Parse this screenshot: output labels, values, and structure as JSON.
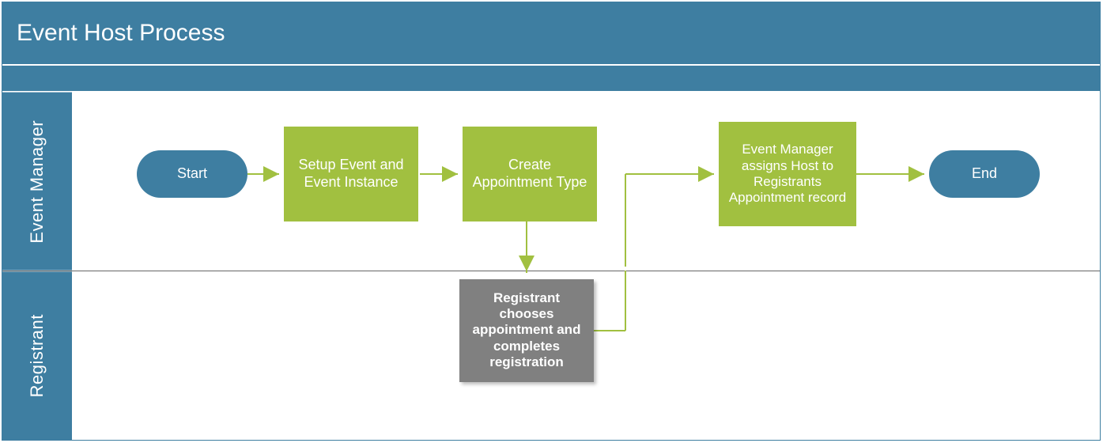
{
  "diagram": {
    "title": "Event Host Process",
    "lanes": {
      "em": {
        "label": "Event Manager"
      },
      "reg": {
        "label": "Registrant"
      }
    },
    "nodes": {
      "start": {
        "label": "Start"
      },
      "setup": {
        "label": "Setup Event and Event Instance"
      },
      "create": {
        "label": "Create Appointment Type"
      },
      "assign": {
        "label": "Event Manager assigns Host to Registrants Appointment record"
      },
      "end": {
        "label": "End"
      },
      "registrant": {
        "label": "Registrant chooses appointment and completes registration"
      }
    },
    "colors": {
      "blue": "#3e7ea1",
      "green": "#a1c040",
      "grey": "#808080"
    }
  }
}
